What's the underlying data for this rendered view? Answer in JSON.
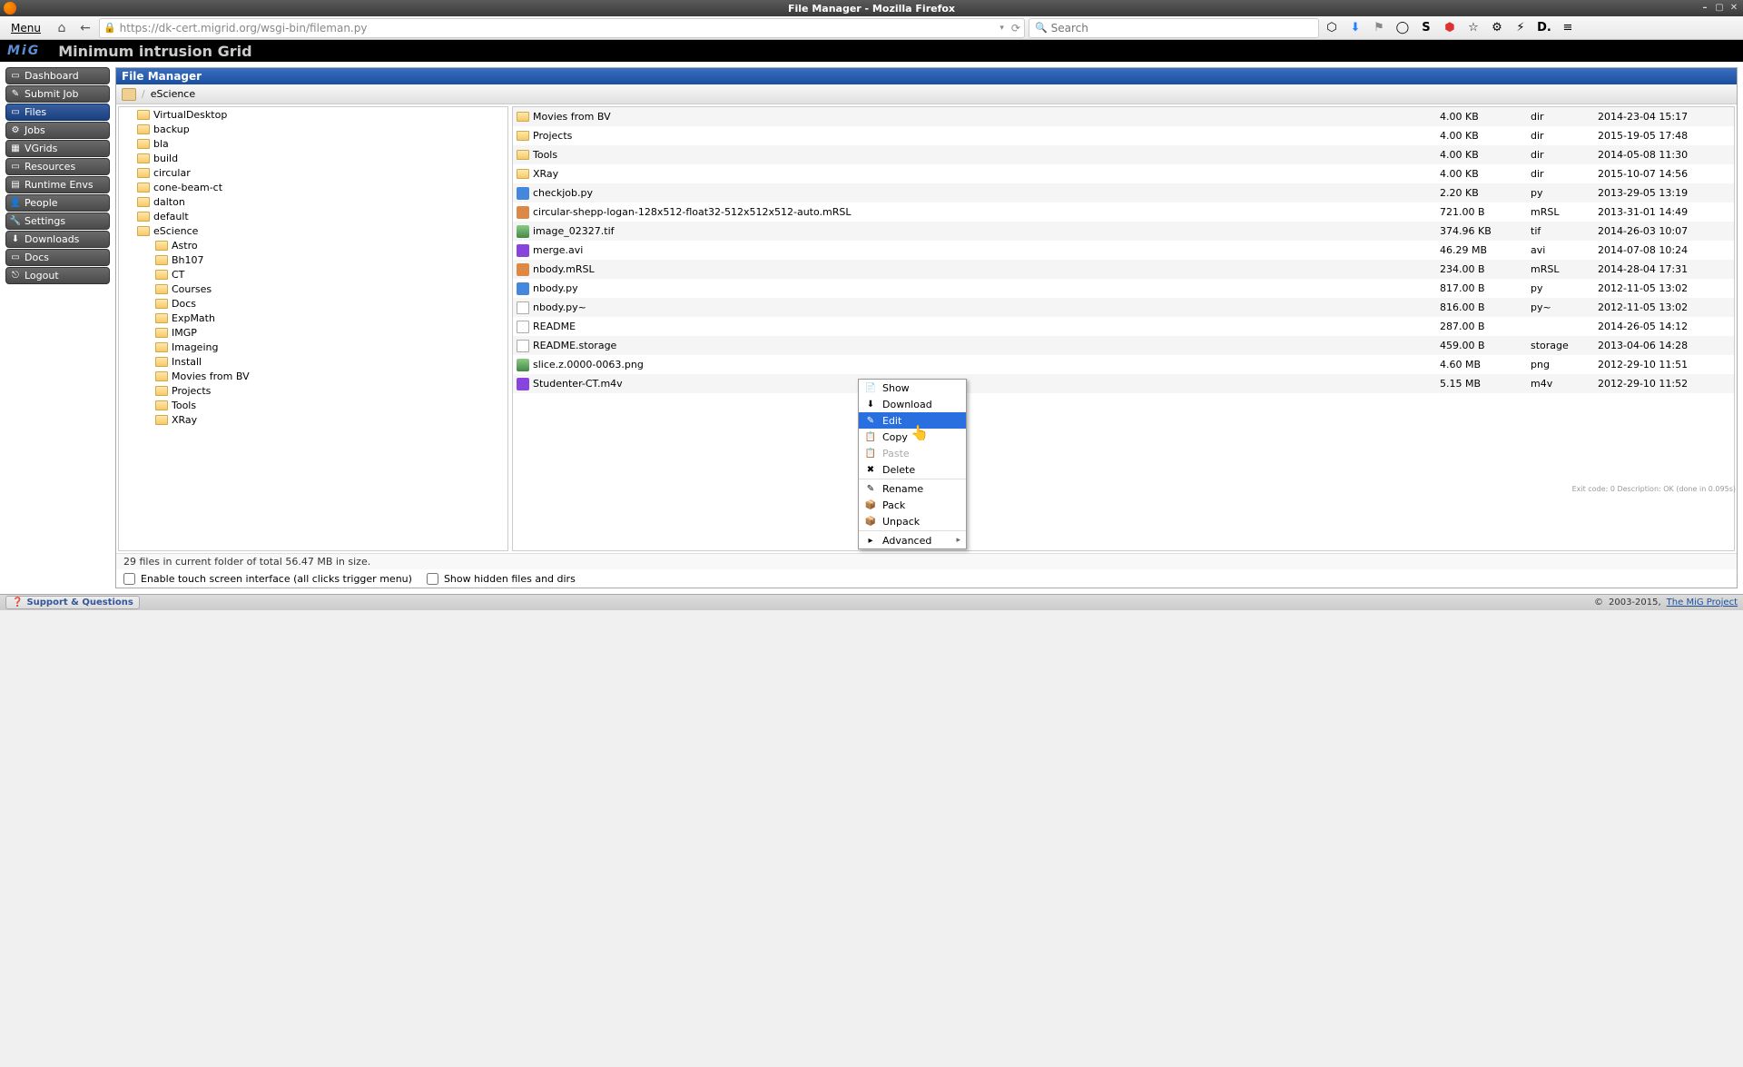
{
  "window": {
    "title": "File Manager - Mozilla Firefox",
    "menu_label": "Menu"
  },
  "urlbar": {
    "url": "https://dk-cert.migrid.org/wsgi-bin/fileman.py"
  },
  "searchbar": {
    "placeholder": "Search"
  },
  "brand": {
    "logo": "MiG",
    "title": "Minimum intrusion Grid"
  },
  "nav": {
    "items": [
      {
        "label": "Dashboard",
        "icon": "▭"
      },
      {
        "label": "Submit Job",
        "icon": "✎"
      },
      {
        "label": "Files",
        "icon": "▭",
        "active": true
      },
      {
        "label": "Jobs",
        "icon": "⚙"
      },
      {
        "label": "VGrids",
        "icon": "▦"
      },
      {
        "label": "Resources",
        "icon": "▭"
      },
      {
        "label": "Runtime Envs",
        "icon": "▤"
      },
      {
        "label": "People",
        "icon": "👤"
      },
      {
        "label": "Settings",
        "icon": "🔧"
      },
      {
        "label": "Downloads",
        "icon": "⬇"
      },
      {
        "label": "Docs",
        "icon": "▭"
      },
      {
        "label": "Logout",
        "icon": "⎋"
      }
    ]
  },
  "fm": {
    "title": "File Manager",
    "breadcrumb": {
      "sep": "/",
      "current": "eScience"
    },
    "tree": [
      {
        "label": "VirtualDesktop",
        "level": 1
      },
      {
        "label": "backup",
        "level": 1
      },
      {
        "label": "bla",
        "level": 1
      },
      {
        "label": "build",
        "level": 1
      },
      {
        "label": "circular",
        "level": 1
      },
      {
        "label": "cone-beam-ct",
        "level": 1
      },
      {
        "label": "dalton",
        "level": 1
      },
      {
        "label": "default",
        "level": 1
      },
      {
        "label": "eScience",
        "level": 1
      },
      {
        "label": "Astro",
        "level": 2
      },
      {
        "label": "Bh107",
        "level": 2
      },
      {
        "label": "CT",
        "level": 2
      },
      {
        "label": "Courses",
        "level": 2
      },
      {
        "label": "Docs",
        "level": 2
      },
      {
        "label": "ExpMath",
        "level": 2
      },
      {
        "label": "IMGP",
        "level": 2
      },
      {
        "label": "Imageing",
        "level": 2
      },
      {
        "label": "Install",
        "level": 2
      },
      {
        "label": "Movies from BV",
        "level": 2
      },
      {
        "label": "Projects",
        "level": 2
      },
      {
        "label": "Tools",
        "level": 2
      },
      {
        "label": "XRay",
        "level": 2
      }
    ],
    "files": [
      {
        "name": "Movies from BV",
        "size": "4.00 KB",
        "type": "dir",
        "date": "2014-23-04 15:17",
        "icon": "folder"
      },
      {
        "name": "Projects",
        "size": "4.00 KB",
        "type": "dir",
        "date": "2015-19-05 17:48",
        "icon": "folder"
      },
      {
        "name": "Tools",
        "size": "4.00 KB",
        "type": "dir",
        "date": "2014-05-08 11:30",
        "icon": "folder"
      },
      {
        "name": "XRay",
        "size": "4.00 KB",
        "type": "dir",
        "date": "2015-10-07 14:56",
        "icon": "folder"
      },
      {
        "name": "checkjob.py",
        "size": "2.20 KB",
        "type": "py",
        "date": "2013-29-05 13:19",
        "icon": "py"
      },
      {
        "name": "circular-shepp-logan-128x512-float32-512x512x512-auto.mRSL",
        "size": "721.00 B",
        "type": "mRSL",
        "date": "2013-31-01 14:49",
        "icon": "mrsl"
      },
      {
        "name": "image_02327.tif",
        "size": "374.96 KB",
        "type": "tif",
        "date": "2014-26-03 10:07",
        "icon": "img"
      },
      {
        "name": "merge.avi",
        "size": "46.29 MB",
        "type": "avi",
        "date": "2014-07-08 10:24",
        "icon": "vid"
      },
      {
        "name": "nbody.mRSL",
        "size": "234.00 B",
        "type": "mRSL",
        "date": "2014-28-04 17:31",
        "icon": "mrsl"
      },
      {
        "name": "nbody.py",
        "size": "817.00 B",
        "type": "py",
        "date": "2012-11-05 13:02",
        "icon": "py"
      },
      {
        "name": "nbody.py~",
        "size": "816.00 B",
        "type": "py~",
        "date": "2012-11-05 13:02",
        "icon": "txt"
      },
      {
        "name": "README",
        "size": "287.00 B",
        "type": "",
        "date": "2014-26-05 14:12",
        "icon": "txt"
      },
      {
        "name": "README.storage",
        "size": "459.00 B",
        "type": "storage",
        "date": "2013-04-06 14:28",
        "icon": "txt"
      },
      {
        "name": "slice.z.0000-0063.png",
        "size": "4.60 MB",
        "type": "png",
        "date": "2012-29-10 11:51",
        "icon": "img"
      },
      {
        "name": "Studenter-CT.m4v",
        "size": "5.15 MB",
        "type": "m4v",
        "date": "2012-29-10 11:52",
        "icon": "vid"
      }
    ],
    "status": "29 files in current folder of total 56.47 MB in size.",
    "opt_touch": "Enable touch screen interface (all clicks trigger menu)",
    "opt_hidden": "Show hidden files and dirs"
  },
  "ctx": {
    "items": [
      {
        "label": "Show",
        "icon": "📄"
      },
      {
        "label": "Download",
        "icon": "⬇"
      },
      {
        "label": "Edit",
        "icon": "✎",
        "sel": true
      },
      {
        "label": "Copy",
        "icon": "📋"
      },
      {
        "label": "Paste",
        "icon": "📋",
        "disabled": true
      },
      {
        "label": "Delete",
        "icon": "✖"
      },
      {
        "sep": true
      },
      {
        "label": "Rename",
        "icon": "✎"
      },
      {
        "label": "Pack",
        "icon": "📦"
      },
      {
        "label": "Unpack",
        "icon": "📦"
      },
      {
        "sep": true
      },
      {
        "label": "Advanced",
        "icon": "▸",
        "arrow": true
      }
    ]
  },
  "footer": {
    "support": "Support & Questions",
    "exit": "Exit code: 0 Description: OK (done in 0.095s)",
    "copyright": "2003-2015,",
    "link": "The MiG Project"
  }
}
